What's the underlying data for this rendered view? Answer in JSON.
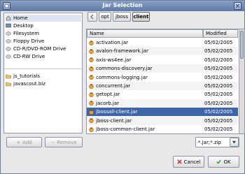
{
  "window": {
    "title": "Jar Selection"
  },
  "sidebar": {
    "places": [
      {
        "label": "Home",
        "icon": "home-icon"
      },
      {
        "label": "Desktop",
        "icon": "desktop-icon"
      },
      {
        "label": "Filesystem",
        "icon": "drive-icon"
      },
      {
        "label": "Floppy Drive",
        "icon": "floppy-icon"
      },
      {
        "label": "CD-R/DVD-ROM Drive",
        "icon": "cdrom-icon"
      },
      {
        "label": "CD-RW Drive",
        "icon": "cdrom-icon"
      }
    ],
    "bookmarks": [
      {
        "label": "js_tutorials",
        "icon": "folder-icon"
      },
      {
        "label": "javascout.biz",
        "icon": "folder-icon"
      }
    ],
    "add_label": "Add",
    "remove_label": "Remove"
  },
  "path": {
    "segments": [
      "opt",
      "jboss",
      "client"
    ]
  },
  "files": {
    "col_name": "Name",
    "col_modified": "Modified",
    "rows": [
      {
        "name": "activation.jar",
        "modified": "05/02/2005"
      },
      {
        "name": "avalon-framework.jar",
        "modified": "05/02/2005"
      },
      {
        "name": "axis-ws4ee.jar",
        "modified": "05/02/2005"
      },
      {
        "name": "commons-discovery.jar",
        "modified": "05/02/2005"
      },
      {
        "name": "commons-logging.jar",
        "modified": "05/02/2005"
      },
      {
        "name": "concurrent.jar",
        "modified": "05/02/2005"
      },
      {
        "name": "getopt.jar",
        "modified": "05/02/2005"
      },
      {
        "name": "jacorb.jar",
        "modified": "05/02/2005"
      },
      {
        "name": "jbossall-client.jar",
        "modified": "05/02/2005"
      },
      {
        "name": "jboss-client.jar",
        "modified": "05/02/2005"
      },
      {
        "name": "jboss-common-client.jar",
        "modified": "05/02/2005"
      }
    ],
    "selected": 8
  },
  "filter": {
    "value": "*.jar;*.zip"
  },
  "actions": {
    "cancel_label": "Cancel",
    "ok_label": "OK"
  },
  "colors": {
    "selection": "#3d66a8",
    "titlebar": "#5e79a6"
  }
}
